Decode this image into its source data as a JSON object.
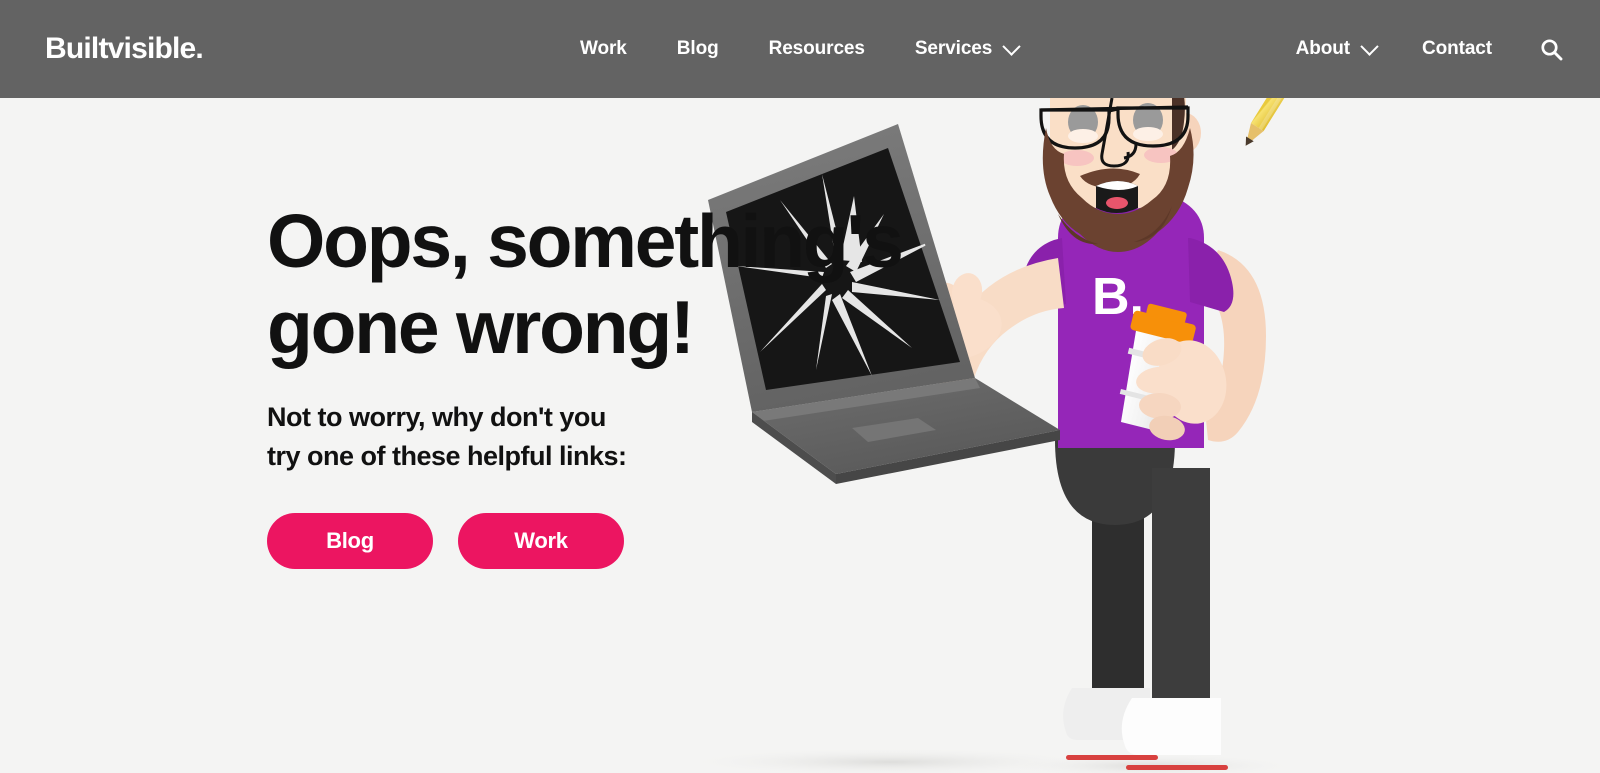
{
  "site": {
    "logo": "Builtvisible.",
    "header_bg": "#636363",
    "page_bg": "#f4f4f3",
    "accent": "#ec1561",
    "shirt_color": "#9526b8"
  },
  "nav": {
    "main_items": [
      {
        "label": "Work",
        "has_dropdown": false
      },
      {
        "label": "Blog",
        "has_dropdown": false
      },
      {
        "label": "Resources",
        "has_dropdown": false
      },
      {
        "label": "Services",
        "has_dropdown": true
      }
    ],
    "right_items": [
      {
        "label": "About",
        "has_dropdown": true
      },
      {
        "label": "Contact",
        "has_dropdown": false
      }
    ],
    "search_icon": "search-icon"
  },
  "hero": {
    "heading": "Oops, something's\ngone wrong!",
    "subtext": "Not to worry, why don't you\ntry one of these helpful links:",
    "buttons": [
      {
        "label": "Blog"
      },
      {
        "label": "Work"
      }
    ]
  },
  "illustration": {
    "description": "bearded man with glasses holding a coffee cup beside a cracked laptop",
    "shirt_logo": "B.",
    "items": [
      "pencil-icon",
      "coffee-cup-icon",
      "broken-laptop-icon",
      "character-icon"
    ]
  }
}
